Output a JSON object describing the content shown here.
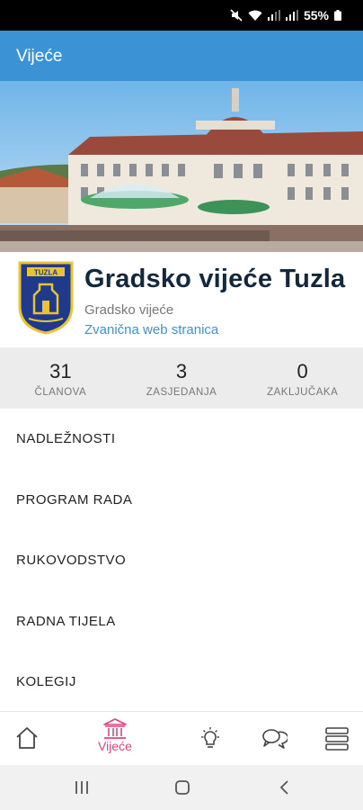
{
  "status_bar": {
    "battery_text": "55%"
  },
  "app_bar": {
    "title": "Vijeće"
  },
  "hero": {
    "image": "Tuzla city hall building with fountain"
  },
  "council": {
    "name": "Gradsko vijeće Tuzla",
    "type": "Gradsko vijeće",
    "website_link": "Zvanična web stranica",
    "crest_text": "TUZLA"
  },
  "stats": [
    {
      "value": "31",
      "label": "ČLANOVA"
    },
    {
      "value": "3",
      "label": "ZASJEDANJA"
    },
    {
      "value": "0",
      "label": "ZAKLJUČAKA"
    }
  ],
  "menu": [
    {
      "label": "NADLEŽNOSTI"
    },
    {
      "label": "PROGRAM RADA"
    },
    {
      "label": "RUKOVODSTVO"
    },
    {
      "label": "RADNA TIJELA"
    },
    {
      "label": "KOLEGIJ"
    }
  ],
  "bottom_nav": {
    "active_label": "Vijeće",
    "items": [
      "home-icon",
      "building-icon",
      "lightbulb-icon",
      "chat-icon",
      "menu-icon"
    ]
  },
  "colors": {
    "accent": "#3b93d6",
    "active_tab": "#e0457b",
    "title": "#13283d"
  }
}
